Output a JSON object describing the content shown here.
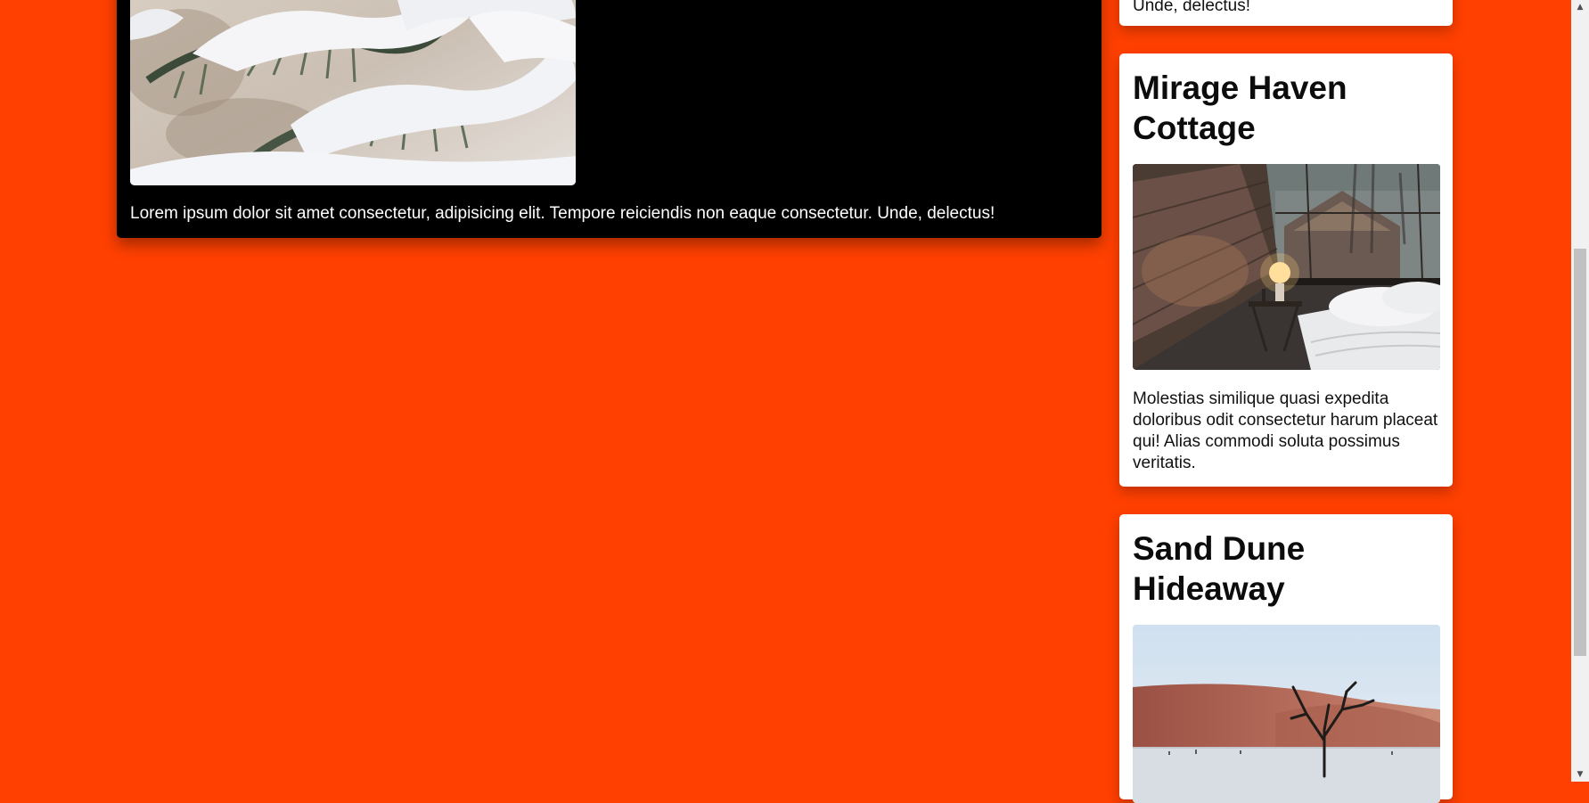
{
  "main_card": {
    "image_icon": "snowy-pine-branches-photo",
    "text": "Lorem ipsum dolor sit amet consectetur, adipisicing elit. Tempore reiciendis non eaque consectetur. Unde, delectus!"
  },
  "top_card": {
    "text": "Unde, delectus!"
  },
  "cards": [
    {
      "title": "Mirage Haven Cottage",
      "image_icon": "cabin-bedroom-photo",
      "text": "Molestias similique quasi expedita doloribus odit consectetur harum placeat qui! Alias commodi soluta possimus veritatis."
    },
    {
      "title": "Sand Dune Hideaway",
      "image_icon": "desert-dead-tree-photo"
    }
  ],
  "scrollbar": {
    "up_icon": "▲",
    "down_icon": "▼"
  },
  "colors": {
    "background": "#ff4000",
    "main_card": "#000000",
    "side_card": "#ffffff"
  }
}
